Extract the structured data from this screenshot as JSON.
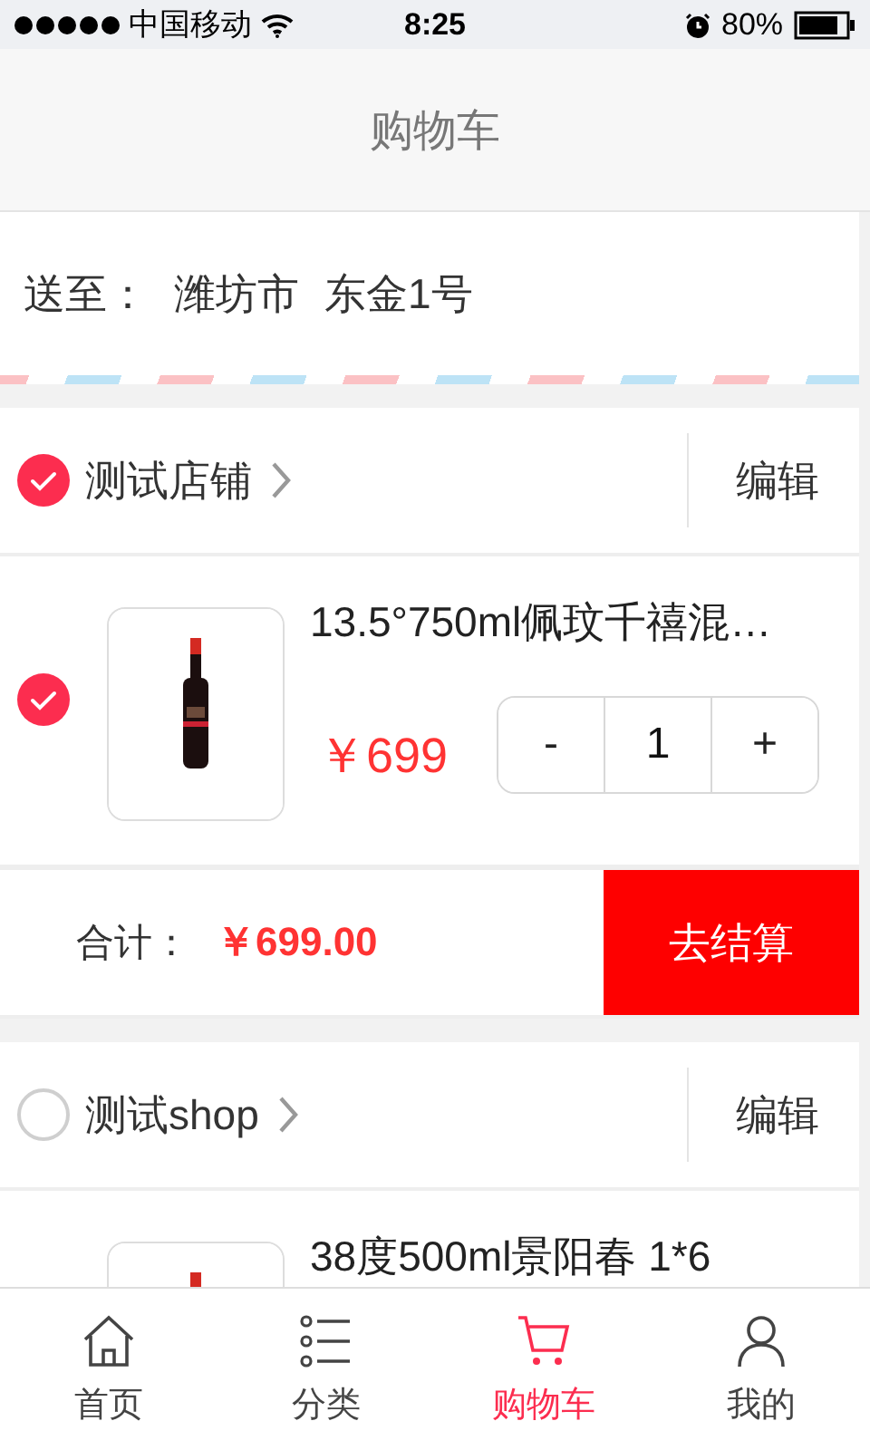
{
  "status_bar": {
    "carrier": "中国移动",
    "time": "8:25",
    "battery": "80%"
  },
  "title": "购物车",
  "address": {
    "label": "送至：",
    "city": "潍坊市",
    "street": "东金1号"
  },
  "shops": [
    {
      "name": "测试店铺",
      "checked": true,
      "edit": "编辑",
      "items": [
        {
          "name": "13.5°750ml佩玟千禧混…",
          "checked": true,
          "price": "￥699",
          "quantity": "1",
          "minus": "-",
          "plus": "+"
        }
      ],
      "total": {
        "label": "合计：",
        "amount": "￥699.00",
        "button": "去结算"
      }
    },
    {
      "name": "测试shop",
      "checked": false,
      "edit": "编辑",
      "items": [
        {
          "name": "38度500ml景阳春 1*6"
        }
      ]
    }
  ],
  "tabs": [
    {
      "label": "首页",
      "kind": "home",
      "selected": false
    },
    {
      "label": "分类",
      "kind": "list",
      "selected": false
    },
    {
      "label": "购物车",
      "kind": "cart",
      "selected": true
    },
    {
      "label": "我的",
      "kind": "person",
      "selected": false
    }
  ]
}
